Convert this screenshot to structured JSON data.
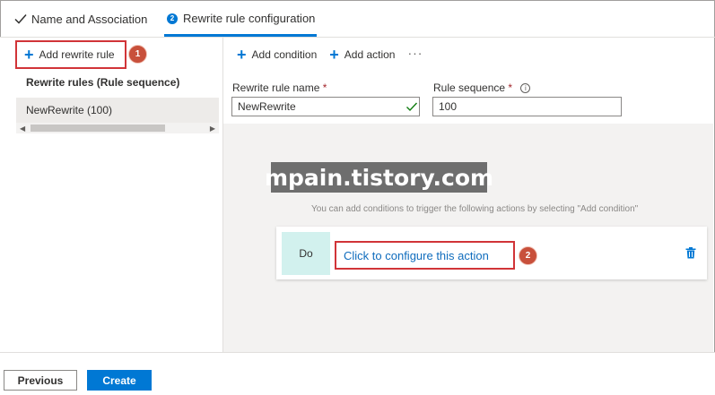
{
  "tabs": {
    "tab1_label": "Name and Association",
    "tab2_step": "2",
    "tab2_label": "Rewrite rule configuration"
  },
  "left": {
    "add_rule_label": "Add rewrite rule",
    "badge1": "1",
    "rules_header": "Rewrite rules (Rule sequence)",
    "rules": [
      {
        "label": "NewRewrite (100)"
      }
    ]
  },
  "toolbar": {
    "add_condition_label": "Add condition",
    "add_action_label": "Add action",
    "more_label": "···"
  },
  "form": {
    "name_label": "Rewrite rule name",
    "name_required": "*",
    "name_value": "NewRewrite",
    "seq_label": "Rule sequence",
    "seq_required": "*",
    "seq_value": "100",
    "info_glyph": "i"
  },
  "watermark": "mpain.tistory.com",
  "hint": "You can add conditions to trigger the following actions by selecting \"Add condition\"",
  "action": {
    "do_label": "Do",
    "configure_label": "Click to configure this action",
    "badge2": "2"
  },
  "footer": {
    "previous_label": "Previous",
    "create_label": "Create"
  },
  "colors": {
    "accent": "#0078d4",
    "highlight_border": "#d13438",
    "badge": "#c8503b",
    "do_bg": "#d2f1ee"
  }
}
